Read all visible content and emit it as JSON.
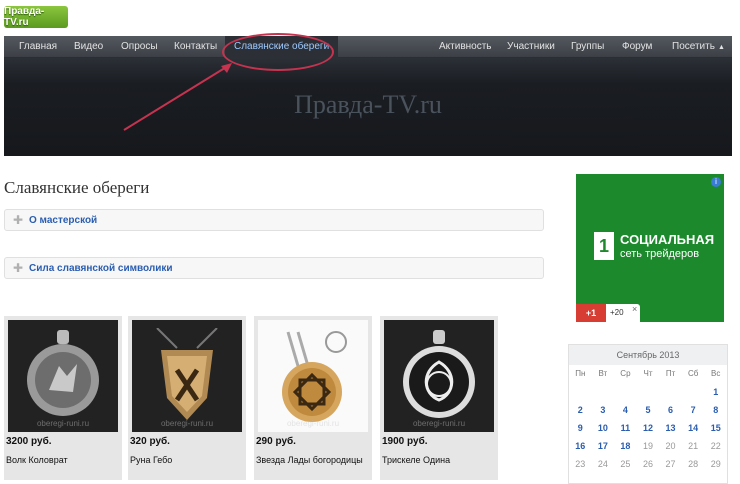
{
  "logo": {
    "text": "Правда-TV.ru"
  },
  "nav": {
    "left": [
      "Главная",
      "Видео",
      "Опросы",
      "Контакты"
    ],
    "active": "Славянские обереги",
    "right": [
      "Активность",
      "Участники",
      "Группы",
      "Форум",
      "Посетить"
    ]
  },
  "header": {
    "title": "Правда-TV.ru"
  },
  "page": {
    "title": "Славянские обереги"
  },
  "accordion": [
    "О мастерской",
    "Сила славянской символики"
  ],
  "products": [
    {
      "price": "3200 руб.",
      "name": "Волк Коловрат"
    },
    {
      "price": "320 руб.",
      "name": "Руна Гебо"
    },
    {
      "price": "290 руб.",
      "name": "Звезда Лады богородицы"
    },
    {
      "price": "1900 руб.",
      "name": "Трискеле Одина"
    }
  ],
  "watermark": "oberegi-runi.ru",
  "ad": {
    "logo": "1",
    "line1": "СОЦИАЛЬНАЯ",
    "line2": "сеть трейдеров",
    "plus": "+1",
    "count": "+20",
    "close": "×",
    "info": "i",
    "brand_color": "#1c8a2c"
  },
  "calendar": {
    "title": "Сентябрь 2013",
    "weekdays": [
      "Пн",
      "Вт",
      "Ср",
      "Чт",
      "Пт",
      "Сб",
      "Вс"
    ],
    "rows": [
      [
        "",
        "",
        "",
        "",
        "",
        "",
        "1"
      ],
      [
        "2",
        "3",
        "4",
        "5",
        "6",
        "7",
        "8"
      ],
      [
        "9",
        "10",
        "11",
        "12",
        "13",
        "14",
        "15"
      ],
      [
        "16",
        "17",
        "18",
        "19",
        "20",
        "21",
        "22"
      ],
      [
        "23",
        "24",
        "25",
        "26",
        "27",
        "28",
        "29"
      ]
    ]
  },
  "colors": {
    "accent": "#2a5db0",
    "highlight": "#c7334f"
  }
}
